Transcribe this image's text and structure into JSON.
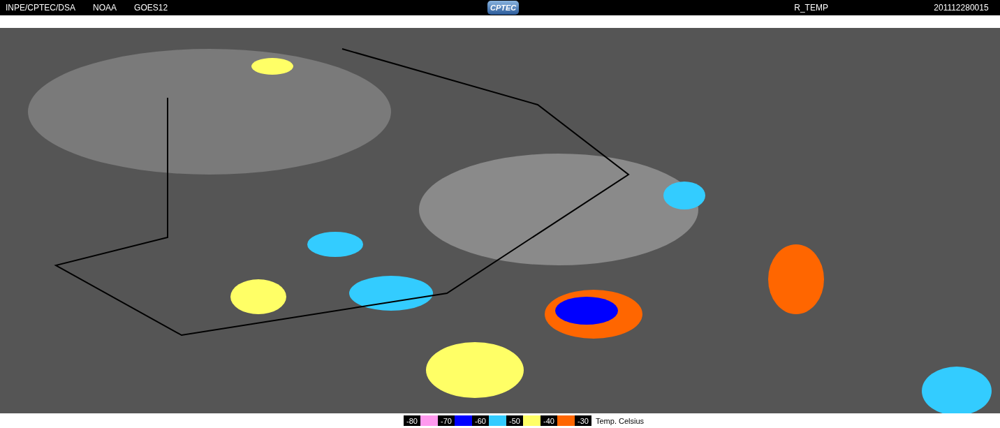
{
  "header": {
    "left": [
      "INPE/CPTEC/DSA",
      "NOAA",
      "GOES12"
    ],
    "logo": "CPTEC",
    "product": "R_TEMP",
    "timestamp": "201112280015"
  },
  "legend": {
    "items": [
      {
        "kind": "label",
        "text": "-80"
      },
      {
        "kind": "swatch",
        "color": "#ff99ee"
      },
      {
        "kind": "label",
        "text": "-70"
      },
      {
        "kind": "swatch",
        "color": "#0000ff"
      },
      {
        "kind": "label",
        "text": "-60"
      },
      {
        "kind": "swatch",
        "color": "#33ccff"
      },
      {
        "kind": "label",
        "text": "-50"
      },
      {
        "kind": "swatch",
        "color": "#ffff66"
      },
      {
        "kind": "label",
        "text": "-40"
      },
      {
        "kind": "swatch",
        "color": "#ff6600"
      },
      {
        "kind": "label",
        "text": "-30"
      }
    ],
    "unit": "Temp. Celsius"
  }
}
